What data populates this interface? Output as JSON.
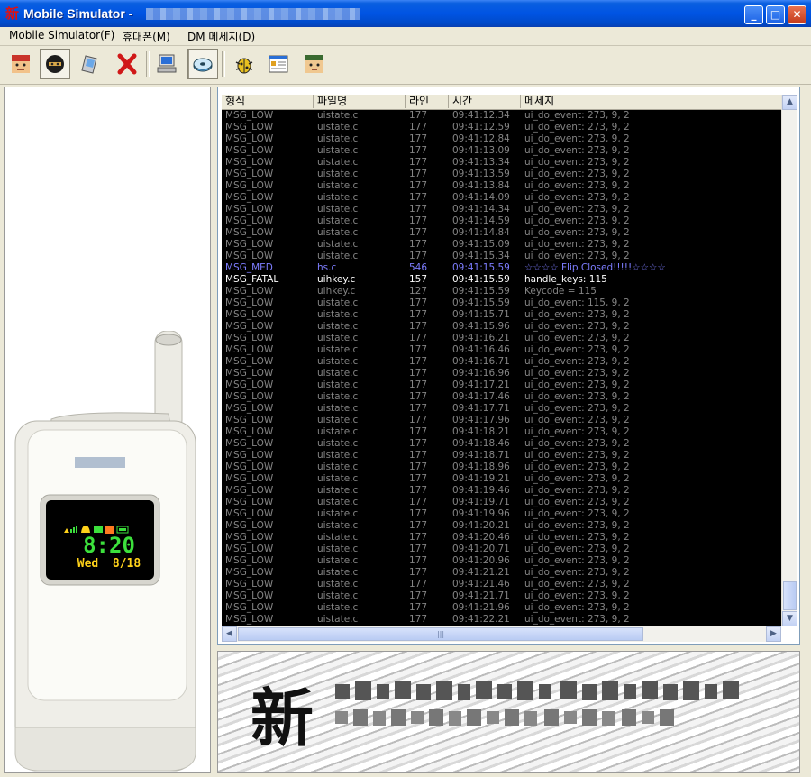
{
  "window": {
    "title": "Mobile Simulator -",
    "app_icon": "新",
    "controls": {
      "minimize": "_",
      "maximize": "□",
      "close": "✕"
    }
  },
  "menu": {
    "items": [
      "Mobile Simulator(F)",
      "휴대폰(M)",
      "DM 메세지(D)"
    ]
  },
  "toolbar": {
    "buttons": [
      "character-face-1",
      "ninja-mask",
      "pda-device",
      "red-x",
      "computer",
      "disk",
      "bug",
      "window-list",
      "character-face-2"
    ]
  },
  "phone": {
    "time": "8:20",
    "date": "Wed  8/18"
  },
  "log": {
    "columns": [
      "형식",
      "파일명",
      "라인",
      "시간",
      "메세지"
    ],
    "rows": [
      {
        "type": "MSG_LOW",
        "file": "uistate.c",
        "line": "177",
        "time": "09:41:12.34",
        "msg": "ui_do_event: 273, 9, 2",
        "level": "low"
      },
      {
        "type": "MSG_LOW",
        "file": "uistate.c",
        "line": "177",
        "time": "09:41:12.59",
        "msg": "ui_do_event: 273, 9, 2",
        "level": "low"
      },
      {
        "type": "MSG_LOW",
        "file": "uistate.c",
        "line": "177",
        "time": "09:41:12.84",
        "msg": "ui_do_event: 273, 9, 2",
        "level": "low"
      },
      {
        "type": "MSG_LOW",
        "file": "uistate.c",
        "line": "177",
        "time": "09:41:13.09",
        "msg": "ui_do_event: 273, 9, 2",
        "level": "low"
      },
      {
        "type": "MSG_LOW",
        "file": "uistate.c",
        "line": "177",
        "time": "09:41:13.34",
        "msg": "ui_do_event: 273, 9, 2",
        "level": "low"
      },
      {
        "type": "MSG_LOW",
        "file": "uistate.c",
        "line": "177",
        "time": "09:41:13.59",
        "msg": "ui_do_event: 273, 9, 2",
        "level": "low"
      },
      {
        "type": "MSG_LOW",
        "file": "uistate.c",
        "line": "177",
        "time": "09:41:13.84",
        "msg": "ui_do_event: 273, 9, 2",
        "level": "low"
      },
      {
        "type": "MSG_LOW",
        "file": "uistate.c",
        "line": "177",
        "time": "09:41:14.09",
        "msg": "ui_do_event: 273, 9, 2",
        "level": "low"
      },
      {
        "type": "MSG_LOW",
        "file": "uistate.c",
        "line": "177",
        "time": "09:41:14.34",
        "msg": "ui_do_event: 273, 9, 2",
        "level": "low"
      },
      {
        "type": "MSG_LOW",
        "file": "uistate.c",
        "line": "177",
        "time": "09:41:14.59",
        "msg": "ui_do_event: 273, 9, 2",
        "level": "low"
      },
      {
        "type": "MSG_LOW",
        "file": "uistate.c",
        "line": "177",
        "time": "09:41:14.84",
        "msg": "ui_do_event: 273, 9, 2",
        "level": "low"
      },
      {
        "type": "MSG_LOW",
        "file": "uistate.c",
        "line": "177",
        "time": "09:41:15.09",
        "msg": "ui_do_event: 273, 9, 2",
        "level": "low"
      },
      {
        "type": "MSG_LOW",
        "file": "uistate.c",
        "line": "177",
        "time": "09:41:15.34",
        "msg": "ui_do_event: 273, 9, 2",
        "level": "low"
      },
      {
        "type": "MSG_MED",
        "file": "hs.c",
        "line": "546",
        "time": "09:41:15.59",
        "msg": "☆☆☆☆ Flip Closed!!!!!☆☆☆☆",
        "level": "med"
      },
      {
        "type": "MSG_FATAL",
        "file": "uihkey.c",
        "line": "157",
        "time": "09:41:15.59",
        "msg": "handle_keys: 115",
        "level": "fatal"
      },
      {
        "type": "MSG_LOW",
        "file": "uihkey.c",
        "line": "127",
        "time": "09:41:15.59",
        "msg": "Keycode = 115",
        "level": "low"
      },
      {
        "type": "MSG_LOW",
        "file": "uistate.c",
        "line": "177",
        "time": "09:41:15.59",
        "msg": "ui_do_event: 115, 9, 2",
        "level": "low"
      },
      {
        "type": "MSG_LOW",
        "file": "uistate.c",
        "line": "177",
        "time": "09:41:15.71",
        "msg": "ui_do_event: 273, 9, 2",
        "level": "low"
      },
      {
        "type": "MSG_LOW",
        "file": "uistate.c",
        "line": "177",
        "time": "09:41:15.96",
        "msg": "ui_do_event: 273, 9, 2",
        "level": "low"
      },
      {
        "type": "MSG_LOW",
        "file": "uistate.c",
        "line": "177",
        "time": "09:41:16.21",
        "msg": "ui_do_event: 273, 9, 2",
        "level": "low"
      },
      {
        "type": "MSG_LOW",
        "file": "uistate.c",
        "line": "177",
        "time": "09:41:16.46",
        "msg": "ui_do_event: 273, 9, 2",
        "level": "low"
      },
      {
        "type": "MSG_LOW",
        "file": "uistate.c",
        "line": "177",
        "time": "09:41:16.71",
        "msg": "ui_do_event: 273, 9, 2",
        "level": "low"
      },
      {
        "type": "MSG_LOW",
        "file": "uistate.c",
        "line": "177",
        "time": "09:41:16.96",
        "msg": "ui_do_event: 273, 9, 2",
        "level": "low"
      },
      {
        "type": "MSG_LOW",
        "file": "uistate.c",
        "line": "177",
        "time": "09:41:17.21",
        "msg": "ui_do_event: 273, 9, 2",
        "level": "low"
      },
      {
        "type": "MSG_LOW",
        "file": "uistate.c",
        "line": "177",
        "time": "09:41:17.46",
        "msg": "ui_do_event: 273, 9, 2",
        "level": "low"
      },
      {
        "type": "MSG_LOW",
        "file": "uistate.c",
        "line": "177",
        "time": "09:41:17.71",
        "msg": "ui_do_event: 273, 9, 2",
        "level": "low"
      },
      {
        "type": "MSG_LOW",
        "file": "uistate.c",
        "line": "177",
        "time": "09:41:17.96",
        "msg": "ui_do_event: 273, 9, 2",
        "level": "low"
      },
      {
        "type": "MSG_LOW",
        "file": "uistate.c",
        "line": "177",
        "time": "09:41:18.21",
        "msg": "ui_do_event: 273, 9, 2",
        "level": "low"
      },
      {
        "type": "MSG_LOW",
        "file": "uistate.c",
        "line": "177",
        "time": "09:41:18.46",
        "msg": "ui_do_event: 273, 9, 2",
        "level": "low"
      },
      {
        "type": "MSG_LOW",
        "file": "uistate.c",
        "line": "177",
        "time": "09:41:18.71",
        "msg": "ui_do_event: 273, 9, 2",
        "level": "low"
      },
      {
        "type": "MSG_LOW",
        "file": "uistate.c",
        "line": "177",
        "time": "09:41:18.96",
        "msg": "ui_do_event: 273, 9, 2",
        "level": "low"
      },
      {
        "type": "MSG_LOW",
        "file": "uistate.c",
        "line": "177",
        "time": "09:41:19.21",
        "msg": "ui_do_event: 273, 9, 2",
        "level": "low"
      },
      {
        "type": "MSG_LOW",
        "file": "uistate.c",
        "line": "177",
        "time": "09:41:19.46",
        "msg": "ui_do_event: 273, 9, 2",
        "level": "low"
      },
      {
        "type": "MSG_LOW",
        "file": "uistate.c",
        "line": "177",
        "time": "09:41:19.71",
        "msg": "ui_do_event: 273, 9, 2",
        "level": "low"
      },
      {
        "type": "MSG_LOW",
        "file": "uistate.c",
        "line": "177",
        "time": "09:41:19.96",
        "msg": "ui_do_event: 273, 9, 2",
        "level": "low"
      },
      {
        "type": "MSG_LOW",
        "file": "uistate.c",
        "line": "177",
        "time": "09:41:20.21",
        "msg": "ui_do_event: 273, 9, 2",
        "level": "low"
      },
      {
        "type": "MSG_LOW",
        "file": "uistate.c",
        "line": "177",
        "time": "09:41:20.46",
        "msg": "ui_do_event: 273, 9, 2",
        "level": "low"
      },
      {
        "type": "MSG_LOW",
        "file": "uistate.c",
        "line": "177",
        "time": "09:41:20.71",
        "msg": "ui_do_event: 273, 9, 2",
        "level": "low"
      },
      {
        "type": "MSG_LOW",
        "file": "uistate.c",
        "line": "177",
        "time": "09:41:20.96",
        "msg": "ui_do_event: 273, 9, 2",
        "level": "low"
      },
      {
        "type": "MSG_LOW",
        "file": "uistate.c",
        "line": "177",
        "time": "09:41:21.21",
        "msg": "ui_do_event: 273, 9, 2",
        "level": "low"
      },
      {
        "type": "MSG_LOW",
        "file": "uistate.c",
        "line": "177",
        "time": "09:41:21.46",
        "msg": "ui_do_event: 273, 9, 2",
        "level": "low"
      },
      {
        "type": "MSG_LOW",
        "file": "uistate.c",
        "line": "177",
        "time": "09:41:21.71",
        "msg": "ui_do_event: 273, 9, 2",
        "level": "low"
      },
      {
        "type": "MSG_LOW",
        "file": "uistate.c",
        "line": "177",
        "time": "09:41:21.96",
        "msg": "ui_do_event: 273, 9, 2",
        "level": "low"
      },
      {
        "type": "MSG_LOW",
        "file": "uistate.c",
        "line": "177",
        "time": "09:41:22.21",
        "msg": "ui_do_event: 273, 9, 2",
        "level": "low"
      }
    ]
  },
  "colors": {
    "low": "#848484",
    "med": "#7d7dff",
    "fatal": "#ffffff",
    "phone_time": "#3ce03c",
    "phone_date": "#ffd21a"
  },
  "banner": {
    "logo": "新"
  }
}
